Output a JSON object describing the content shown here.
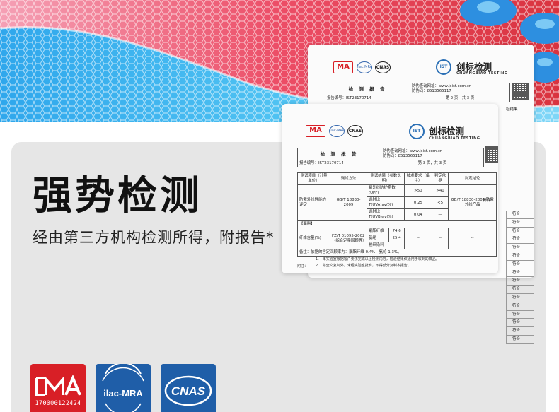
{
  "headline": {
    "title": "强势检测",
    "subtitle": "经由第三方机构检测所得，附报告*"
  },
  "badges": [
    {
      "name": "cma",
      "label": "MA",
      "number": "170000122424",
      "color": "#d81f26"
    },
    {
      "name": "ilac",
      "label": "ilac-MRA",
      "color": "#1f5ea8"
    },
    {
      "name": "cnas",
      "label": "CNAS",
      "color": "#1f5ea8"
    }
  ],
  "report": {
    "mini_logos": {
      "ma": "MA",
      "ilac": "ilac·MRA",
      "cnas": "CNAS"
    },
    "ist": "IST",
    "brand_cn": "创标检测",
    "brand_en": "CHUANGBIAO TESTING",
    "report_title": "检 测 报 告",
    "query_site": "防伪查询网址：www.jsist.com.cn",
    "query_code": "防伪码：8513565117",
    "report_no_label": "报告编号：",
    "report_no": "IST23170714",
    "page_back": "第 2 页，共 3 页",
    "page_front": "第 3 页，共 3 页",
    "columns": [
      "测试项目（计量单位）",
      "测试方法",
      "测试结果（参数说明）",
      "技术要求（备注）",
      "判定依据",
      "判定结论"
    ],
    "uv_item": "防紫外线性能的评定",
    "uv_method": "GB/T 18830-2009",
    "uv_rows": [
      {
        "param": "紫外线防护系数(UPF)",
        "value": ">50",
        "req": ">40"
      },
      {
        "param": "透射比 T(UVA)av(%)",
        "value": "0.25",
        "req": "<5"
      },
      {
        "param": "透射比 T(UVB)av(%)",
        "value": "0.04",
        "req": "—"
      }
    ],
    "uv_basis": "GB/T 18830-2009 防紫外线产品",
    "verdict": "符合",
    "fabric_section": "【面料】",
    "fiber_item": "纤维含量(%)",
    "fiber_method": "FZ/T 01095-2002（综合定量回顾等）",
    "fiber_rows": [
      {
        "param": "聚酯纤维",
        "value": "74.6"
      },
      {
        "param": "氨纶",
        "value": "25.4"
      },
      {
        "param": "梭织染料",
        "value": ""
      }
    ],
    "dash": "--",
    "remark": "备注：依据的含定回顾率为：聚酯纤维-0.4%，氨纶-1.3%。",
    "result_header": "检结果",
    "side_verdicts": [
      "符合",
      "符合",
      "符合",
      "符合",
      "符合",
      "符合",
      "符合",
      "符合",
      "符合",
      "符合",
      "符合",
      "符合",
      "符合",
      "符合",
      "符合",
      "符合"
    ],
    "notes_label": "附注：",
    "notes": [
      "1.　本实验室根据客户要求完成以上检测内容，检验结果仅适用于收到的样品。",
      "2.　除全文复制外，未经实验室批准，不得部分复制本报告。"
    ]
  }
}
